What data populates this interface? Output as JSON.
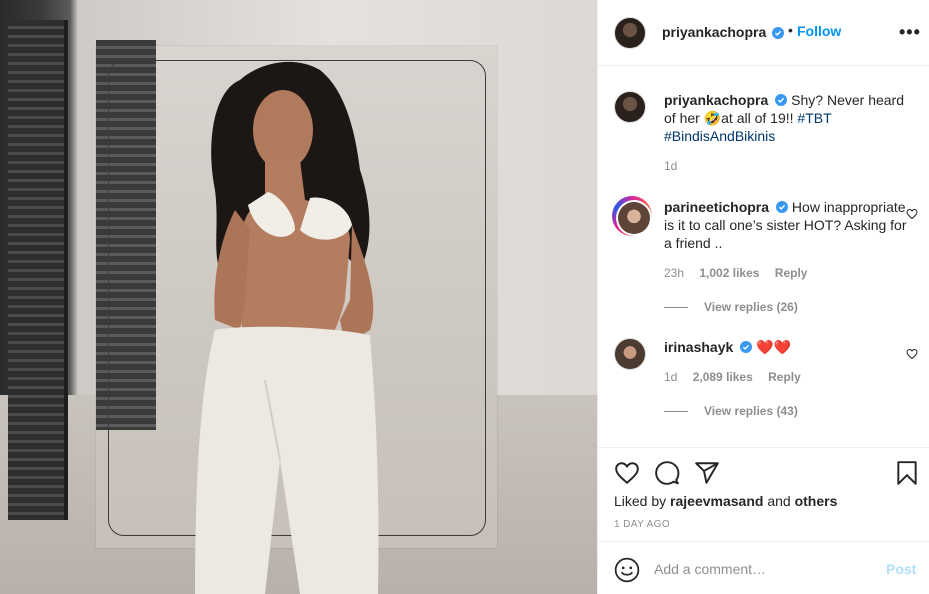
{
  "post": {
    "image_alt": "Photo of woman in white bikini top and white trousers"
  },
  "header": {
    "username": "priyankachopra",
    "separator": "•",
    "follow_label": "Follow",
    "more_label": "•••"
  },
  "caption": {
    "username": "priyankachopra",
    "text_before_emoji": "Shy? Never heard of her ",
    "emoji": "🤣",
    "text_after_emoji": "at all of 19!! ",
    "tags": [
      "#TBT",
      "#BindisAndBikinis"
    ],
    "age": "1d"
  },
  "comments": [
    {
      "username": "parineetichopra",
      "text": "How inappropriate is it to call one’s sister HOT? Asking for a friend ..",
      "age": "23h",
      "likes": "1,002 likes",
      "reply_label": "Reply",
      "view_replies": "View replies (26)"
    },
    {
      "username": "irinashayk",
      "text": "❤️❤️",
      "age": "1d",
      "likes": "2,089 likes",
      "reply_label": "Reply",
      "view_replies": "View replies (43)"
    }
  ],
  "likes": {
    "prefix": "Liked by ",
    "user": "rajeevmasand",
    "middle": " and ",
    "others": "others"
  },
  "timestamp": "1 DAY AGO",
  "add_comment": {
    "placeholder": "Add a comment…",
    "post_label": "Post"
  },
  "colors": {
    "follow": "#0095f6",
    "verified": "#3897f0",
    "post_disabled": "#b2dffc",
    "muted": "#8e8e8e",
    "hashtag": "#00376b"
  }
}
